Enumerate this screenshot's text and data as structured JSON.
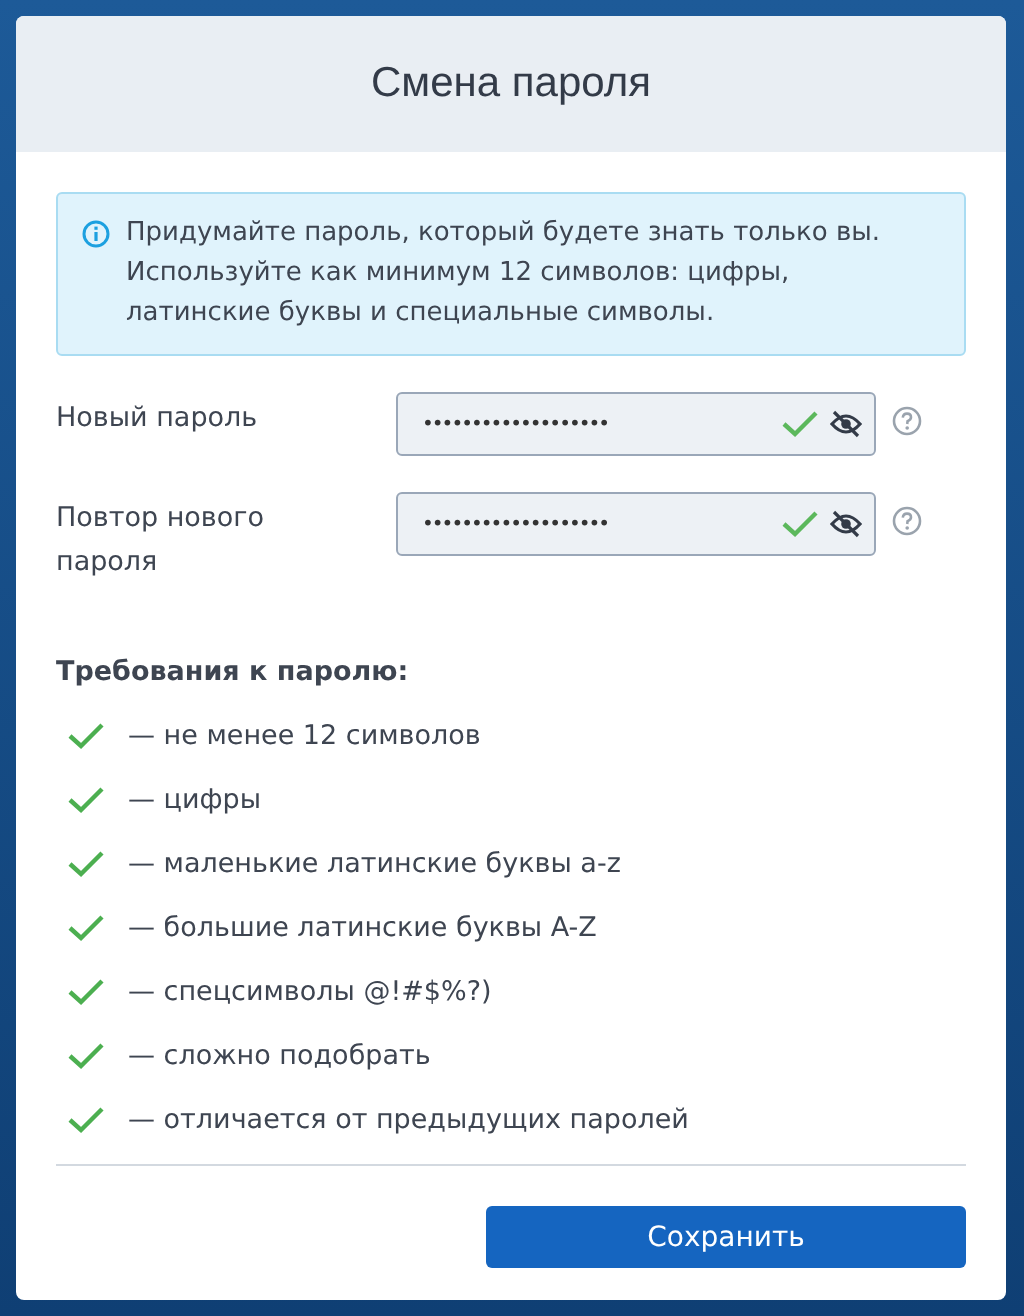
{
  "dialog": {
    "title": "Смена пароля"
  },
  "info": {
    "text": "Придумайте пароль, который будете знать только вы. Используйте как минимум 12 символов: цифры, латинские буквы и специальные символы."
  },
  "fields": [
    {
      "label": "Новый пароль",
      "value": "•••••••••••••••••••",
      "valid": true
    },
    {
      "label": "Повтор нового пароля",
      "value": "•••••••••••••••••••",
      "valid": true
    }
  ],
  "requirements": {
    "title": "Требования к паролю:",
    "items": [
      {
        "text": "— не менее 12 символов",
        "met": true
      },
      {
        "text": "— цифры",
        "met": true
      },
      {
        "text": "— маленькие латинские буквы a-z",
        "met": true
      },
      {
        "text": "— большие латинские буквы A-Z",
        "met": true
      },
      {
        "text": "— спецсимволы @!#$%?)",
        "met": true
      },
      {
        "text": "— сложно подобрать",
        "met": true
      },
      {
        "text": "— отличается от предыдущих паролей",
        "met": true
      }
    ]
  },
  "buttons": [
    {
      "label": "Сохранить"
    }
  ]
}
